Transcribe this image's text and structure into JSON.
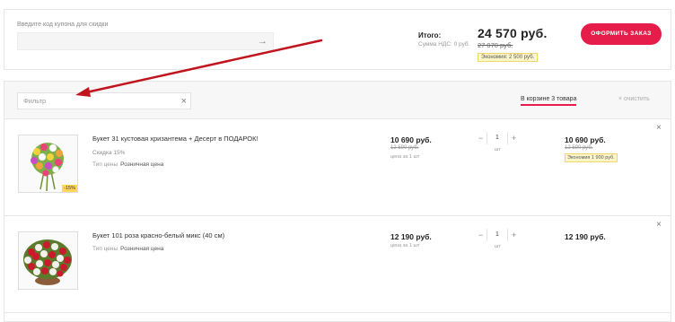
{
  "coupon": {
    "label": "Введите код купона для скидки",
    "arrow_icon": "→"
  },
  "summary": {
    "total_label": "Итого:",
    "vat_label": "Сумма НДС: 0 руб.",
    "total_price": "24 570 руб.",
    "old_price": "27 070 руб.",
    "economy": "Экономия: 2 500 руб.",
    "order_button": "ОФОРМИТЬ ЗАКАЗ",
    "accent_color": "#e61d4b"
  },
  "filter": {
    "placeholder": "Фильтр",
    "clear_icon": "×",
    "cart_count": "В корзине 3 товара",
    "clear_cart": "× очистить"
  },
  "items": [
    {
      "name": "Букет 31 кустовая хризантема + Десерт в ПОДАРОК!",
      "discount_text": "Скидка 15%",
      "discount_tag": "-15%",
      "price_type_key": "Тип цены",
      "price_type_value": "Розничная цена",
      "price": "10 690 руб.",
      "unit_old": "12 590 руб.",
      "unit_note": "цена за 1 шт",
      "qty": "1",
      "qty_minus": "−",
      "qty_plus": "+",
      "qty_unit": "шт",
      "total": "10 690 руб.",
      "total_old": "12 590 руб.",
      "economy": "Экономия 1 900 руб.",
      "remove_icon": "×"
    },
    {
      "name": "Букет 101 роза красно-белый микс (40 см)",
      "price_type_key": "Тип цены",
      "price_type_value": "Розничная цена",
      "price": "12 190 руб.",
      "unit_note": "цена за 1 шт",
      "qty": "1",
      "qty_minus": "−",
      "qty_plus": "+",
      "qty_unit": "шт",
      "total": "12 190 руб.",
      "remove_icon": "×"
    }
  ]
}
